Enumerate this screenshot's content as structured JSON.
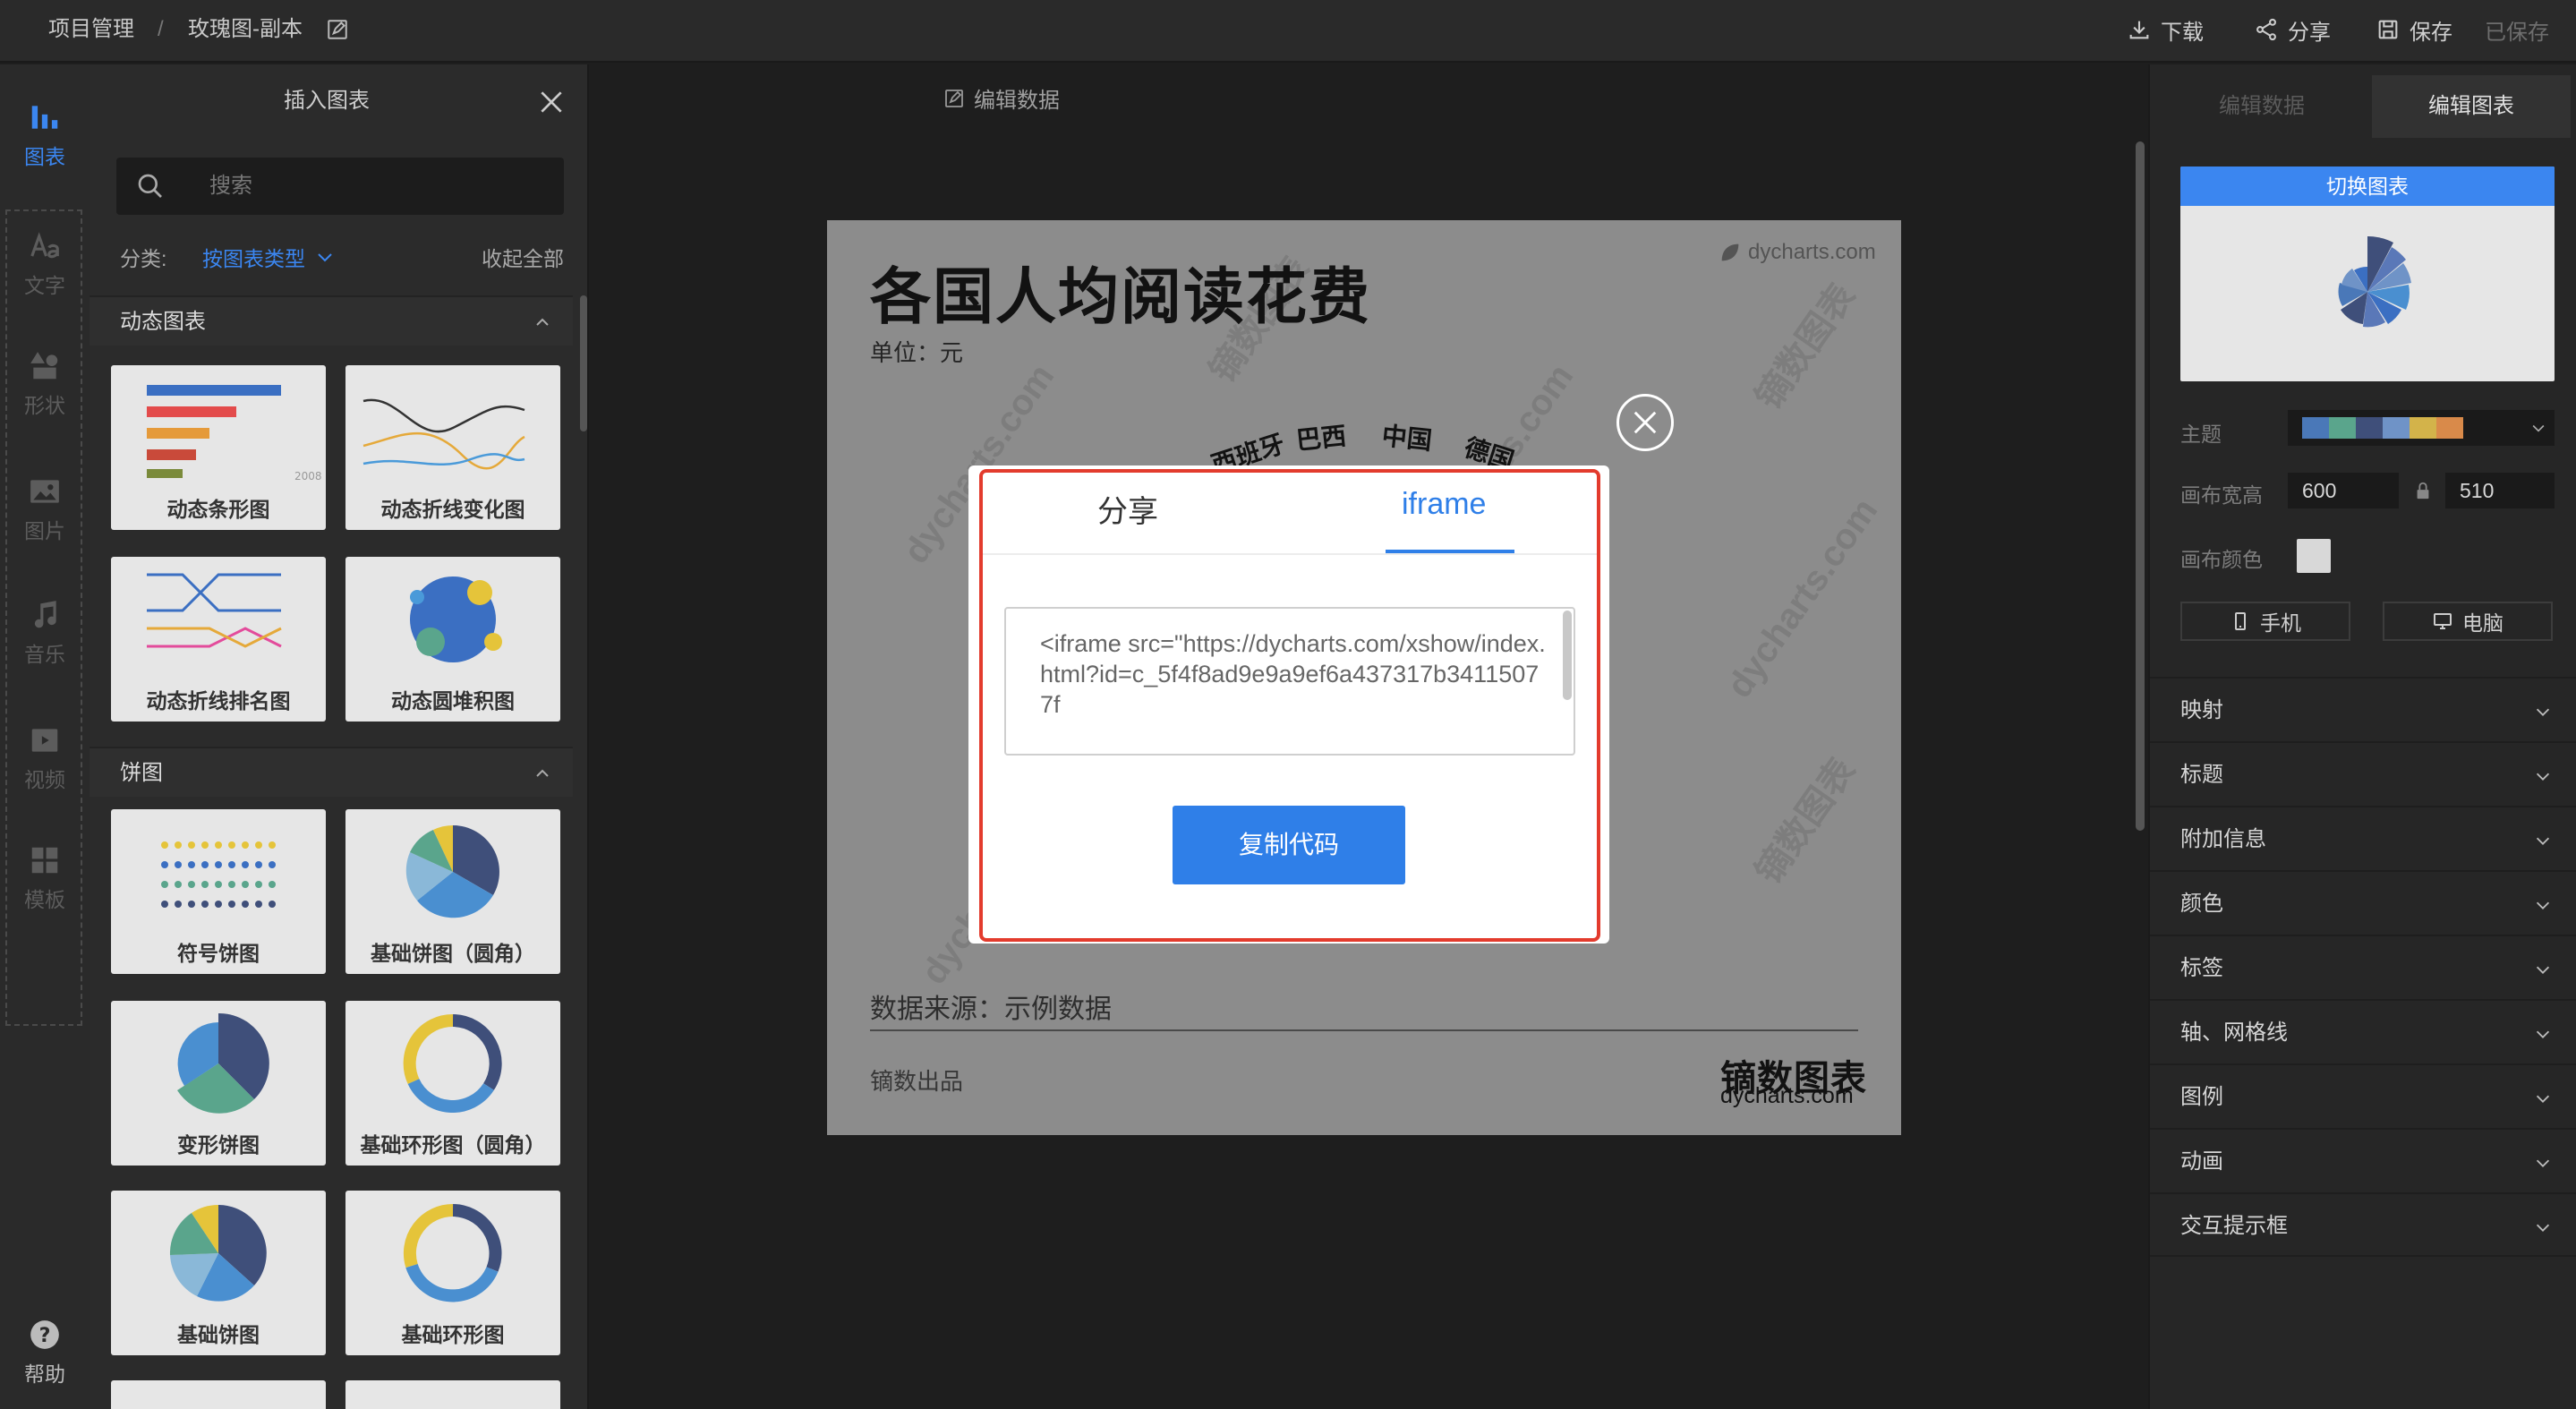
{
  "topbar": {
    "breadcrumb_root": "项目管理",
    "breadcrumb_sep": "/",
    "breadcrumb_current": "玫瑰图-副本",
    "actions": {
      "download": "下载",
      "share": "分享",
      "save": "保存",
      "saved": "已保存"
    }
  },
  "iconbar": {
    "items": [
      {
        "label": "图表",
        "icon": "bar-chart-icon"
      },
      {
        "label": "文字",
        "icon": "text-icon"
      },
      {
        "label": "形状",
        "icon": "shapes-icon"
      },
      {
        "label": "图片",
        "icon": "image-icon"
      },
      {
        "label": "音乐",
        "icon": "music-icon"
      },
      {
        "label": "视频",
        "icon": "video-icon"
      },
      {
        "label": "模板",
        "icon": "template-icon"
      }
    ],
    "help": "帮助"
  },
  "panel": {
    "title": "插入图表",
    "search_placeholder": "搜索",
    "category_label": "分类:",
    "category_value": "按图表类型",
    "collapse_all": "收起全部",
    "groups": [
      {
        "name": "动态图表",
        "items": [
          "动态条形图",
          "动态折线变化图",
          "动态折线排名图",
          "动态圆堆积图"
        ]
      },
      {
        "name": "饼图",
        "items": [
          "符号饼图",
          "基础饼图（圆角）",
          "变形饼图",
          "基础环形图（圆角）",
          "基础饼图",
          "基础环形图"
        ]
      }
    ]
  },
  "center": {
    "header": "编辑数据"
  },
  "artboard": {
    "title": "各国人均阅读花费",
    "unit": "单位：元",
    "logo": "dycharts.com",
    "rose_labels": [
      "西班牙",
      "巴西",
      "中国",
      "德国"
    ],
    "source": "数据来源：示例数据",
    "made_by": "镝数出品",
    "brand": "镝数图表",
    "brand_url": "dycharts.com",
    "watermark": "dycharts.com",
    "watermark_cn": "镝数图表"
  },
  "modal": {
    "tab_share": "分享",
    "tab_iframe": "iframe",
    "code": "<iframe src=\"https://dycharts.com/xshow/index.html?id=c_5f4f8ad9e9a9ef6a437317b34115077f",
    "copy_button": "复制代码"
  },
  "rpanel": {
    "tab_data": "编辑数据",
    "tab_chart": "编辑图表",
    "switch_chart": "切换图表",
    "theme_label": "主题",
    "theme_colors": [
      "#4a78b8",
      "#5aa58c",
      "#3f4f7a",
      "#6f93c7",
      "#d3b34a",
      "#d98a4a"
    ],
    "size_label": "画布宽高",
    "width": "600",
    "height": "510",
    "color_label": "画布颜色",
    "mobile": "手机",
    "desktop": "电脑",
    "sections": [
      "映射",
      "标题",
      "附加信息",
      "颜色",
      "标签",
      "轴、网格线",
      "图例",
      "动画",
      "交互提示框"
    ]
  }
}
